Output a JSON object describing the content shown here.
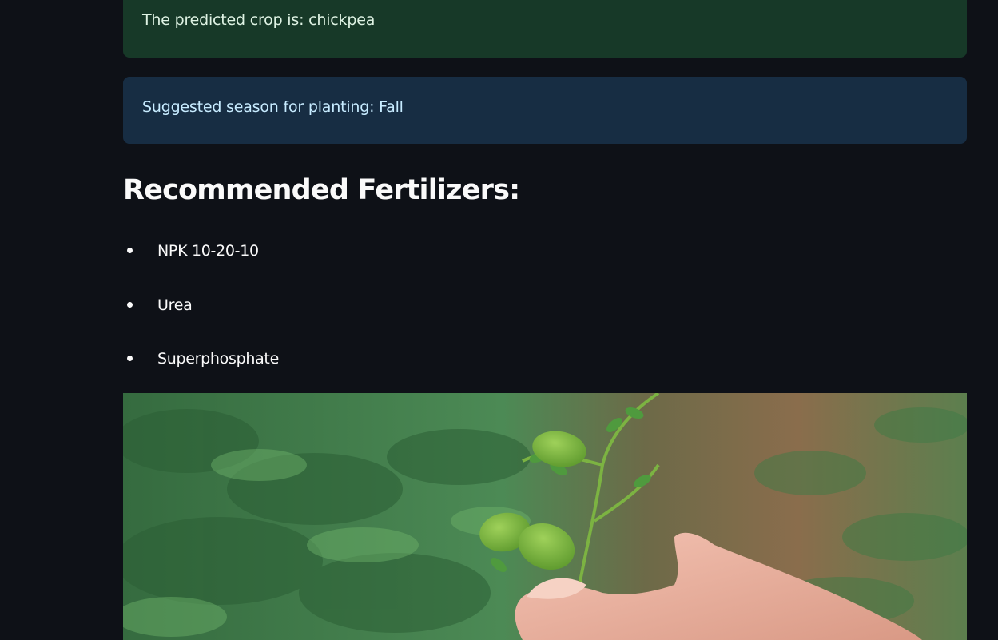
{
  "prediction": {
    "crop_text": "The predicted crop is: chickpea",
    "season_text": "Suggested season for planting: Fall"
  },
  "fertilizers": {
    "heading": "Recommended Fertilizers:",
    "items": [
      {
        "label": "NPK 10-20-10"
      },
      {
        "label": "Urea"
      },
      {
        "label": "Superphosphate"
      }
    ]
  },
  "image": {
    "subject": "chickpea plant with green pods held in a hand",
    "icon": "crop-photo"
  },
  "colors": {
    "background": "#0e1117",
    "success_bg": "#173928",
    "success_text": "#dff3e4",
    "info_bg": "#172d43",
    "info_text": "#c7ebff",
    "text": "#fafafa"
  }
}
